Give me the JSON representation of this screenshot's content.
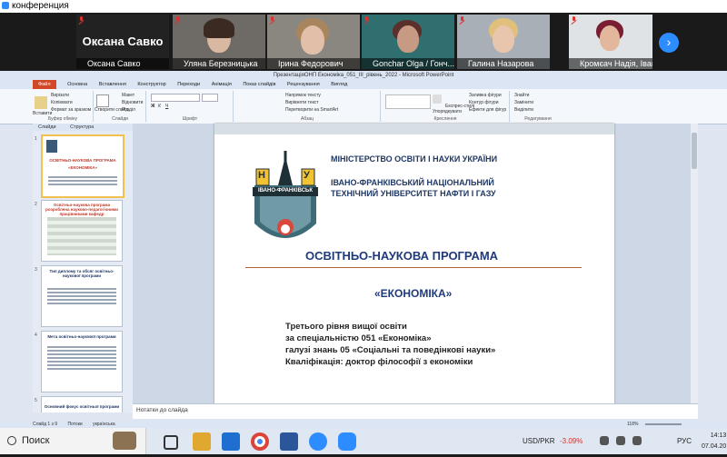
{
  "window": {
    "title": "конференция"
  },
  "gallery": {
    "active_speaker": "Оксана Савко",
    "participants": [
      {
        "name": "Оксана Савко",
        "muted": true
      },
      {
        "name": "Уляна Березницька",
        "muted": true
      },
      {
        "name": "Ірина Федорович",
        "muted": true
      },
      {
        "name": "Gonchar Olga / Гонч...",
        "muted": true
      },
      {
        "name": "Галина Назарова",
        "muted": true
      },
      {
        "name": "Кромєач Надія, Іван...",
        "muted": true
      }
    ],
    "next_page_glyph": "›"
  },
  "powerpoint": {
    "title": "ПрезентаціяОНП Економіка_051_III_рівень_2022 - Microsoft PowerPoint",
    "file_tab": "Файл",
    "tabs": [
      "Основна",
      "Вставлення",
      "Конструктор",
      "Переходи",
      "Анімація",
      "Показ слайдів",
      "Рецензування",
      "Вигляд"
    ],
    "ribbon": {
      "clipboard": {
        "label": "Буфер обміну",
        "paste": "Вставити",
        "cut": "Вирізати",
        "copy": "Копіювати",
        "format_painter": "Формат за зразком"
      },
      "slides": {
        "label": "Слайди",
        "new_slide": "Створити слайд",
        "layout": "Макет",
        "reset": "Відновити",
        "section": "Розділ"
      },
      "font": {
        "label": "Шрифт"
      },
      "paragraph": {
        "label": "Абзац",
        "direction": "Напрямок тексту",
        "align": "Вирівняти текст",
        "smartart": "Перетворити на SmartArt"
      },
      "drawing": {
        "label": "Креслення",
        "arrange": "Упорядкувати",
        "quick_styles": "Експрес-стилі",
        "fill": "Заливка фігури",
        "outline": "Контур фігури",
        "effects": "Ефекти для фігур"
      },
      "editing": {
        "label": "Редагування",
        "find": "Знайти",
        "replace": "Замінити",
        "select": "Виділити"
      }
    },
    "panel_tabs": [
      "Слайди",
      "Структура"
    ],
    "thumbnails": [
      {
        "num": "1",
        "title": "ОСВІТНЬО-НАУКОВА ПРОГРАМА",
        "sub": "«ЕКОНОМІКА»"
      },
      {
        "num": "2",
        "title": "Освітньо-наукова програма розроблена науково-педагогічними працівниками кафедр",
        "sub": ""
      },
      {
        "num": "3",
        "title": "Тип диплому та обсяг освітньо-наукової програми",
        "sub": ""
      },
      {
        "num": "4",
        "title": "Мета освітньо-наукової програми",
        "sub": ""
      },
      {
        "num": "5",
        "title": "Основний фокус освітньої програми",
        "sub": ""
      }
    ],
    "slide": {
      "ministry": "МІНІСТЕРСТВО ОСВІТИ І НАУКИ УКРАЇНИ",
      "university_line1": "ІВАНО-ФРАНКІВСЬКИЙ НАЦІОНАЛЬНИЙ",
      "university_line2": "ТЕХНІЧНИЙ УНІВЕРСИТЕТ НАФТИ І ГАЗУ",
      "logo_text": "ІВАНО-ФРАНКІВСЬК",
      "logo_letter_left": "Н",
      "logo_letter_right": "У",
      "program_title": "ОСВІТНЬО-НАУКОВА ПРОГРАМА",
      "program_name": "«ЕКОНОМІКА»",
      "detail_lines": [
        "Третього рівня вищої освіти",
        "за спеціальністю  051 «Економіка»",
        "галузі знань 05 «Соціальні та поведінкові науки»",
        "Кваліфікація: доктор філософії з економіки"
      ]
    },
    "notes_placeholder": "Нотатки до слайда",
    "status": {
      "slide_counter": "Слайд 1 з 9",
      "theme": "Потоки",
      "language": "українська",
      "zoom": "118%"
    }
  },
  "taskbar": {
    "search_label": "Поиск",
    "currency": "USD/PKR",
    "change": "-3.09%",
    "language": "РУС",
    "time": "14:13",
    "date": "07.04.20"
  },
  "colors": {
    "accent": "#2d8cff",
    "slide_text": "#1f3864",
    "program_title": "#1f3a7a",
    "negative": "#d93025",
    "ppt_file": "#d24726"
  }
}
